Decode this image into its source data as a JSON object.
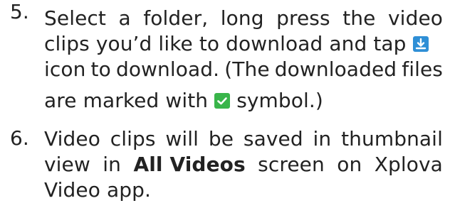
{
  "items": [
    {
      "number": "5.",
      "line1": [
        "Select",
        "a",
        "folder,",
        "long",
        "press",
        "the",
        "video"
      ],
      "line2_before": "clips you’d like to download and tap",
      "line3": [
        "icon",
        "to",
        "download.",
        "(The",
        "downloaded",
        "files"
      ],
      "line4_before": "are marked with",
      "line4_after": "symbol.)",
      "download_icon": "download-icon",
      "check_icon": "checkmark-icon"
    },
    {
      "number": "6.",
      "line1": [
        "Video",
        "clips",
        "will",
        "be",
        "saved",
        "in",
        "thumbnail"
      ],
      "line2": [
        "view",
        "in",
        "All Videos",
        "screen",
        "on",
        "Xplova"
      ],
      "line3": "Video app."
    }
  ],
  "colors": {
    "text": "#222222",
    "download_icon_bg": "#2f8fd6",
    "check_icon_bg": "#39b54a"
  }
}
